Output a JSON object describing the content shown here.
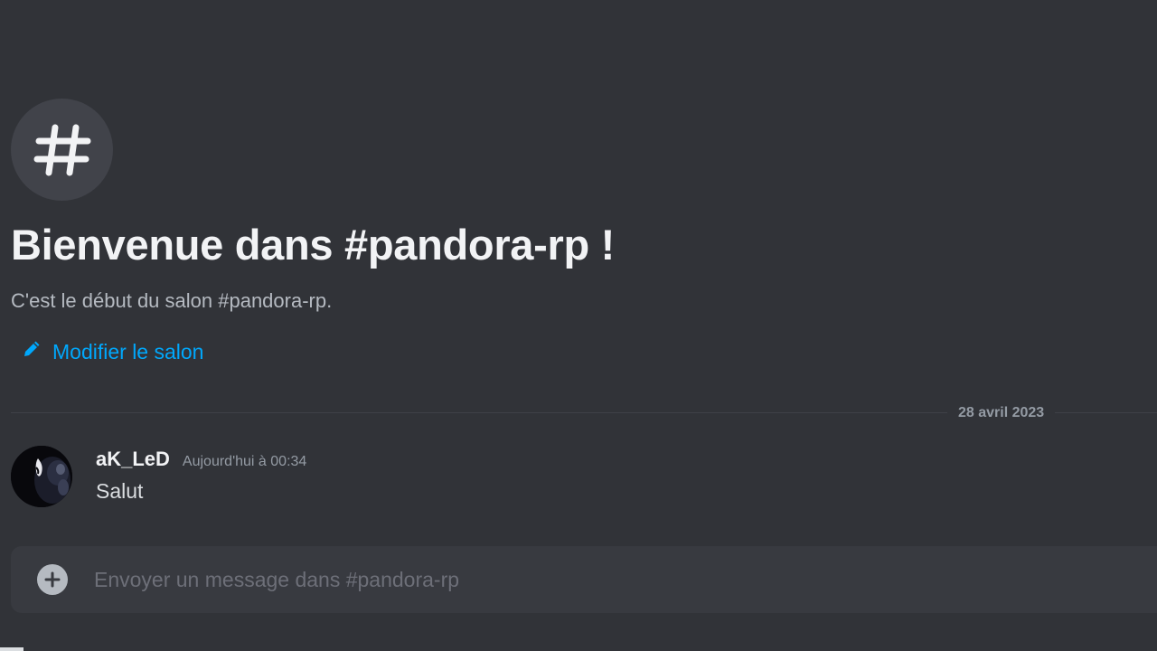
{
  "channel": {
    "icon": "hashtag-icon",
    "welcome_title": "Bienvenue dans #pandora-rp !",
    "welcome_subtitle": "C'est le début du salon #pandora-rp.",
    "edit_label": "Modifier le salon",
    "edit_icon": "pencil-icon"
  },
  "divider": {
    "date": "28 avril 2023"
  },
  "messages": [
    {
      "author": "aK_LeD",
      "timestamp": "Aujourd'hui à 00:34",
      "content": "Salut",
      "avatar": "avatar-image"
    }
  ],
  "composer": {
    "placeholder": "Envoyer un message dans #pandora-rp",
    "attach_icon": "plus-circle-icon"
  },
  "colors": {
    "background": "#313338",
    "link": "#00a8fc",
    "input_background": "#383a40"
  }
}
